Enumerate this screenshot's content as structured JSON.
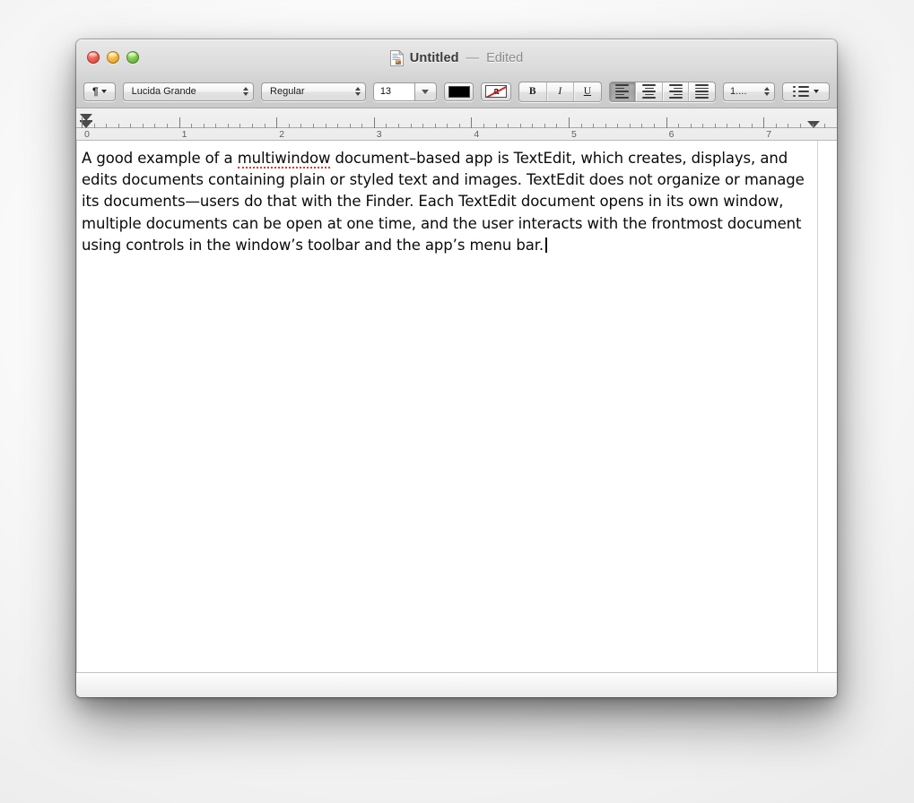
{
  "window": {
    "title": "Untitled",
    "title_separator": "—",
    "status": "Edited",
    "doc_icon": "textedit-document-icon",
    "traffic_lights": [
      {
        "name": "close",
        "label": "Close",
        "color": "#ef5f52"
      },
      {
        "name": "minimize",
        "label": "Minimize",
        "color": "#f6b73c"
      },
      {
        "name": "zoom",
        "label": "Zoom",
        "color": "#7cc84a"
      }
    ]
  },
  "toolbar": {
    "paragraph_style": {
      "glyph": "¶",
      "icon": "pilcrow-icon",
      "label": "Paragraph Styles"
    },
    "font_family": {
      "value": "Lucida Grande"
    },
    "font_typeface": {
      "value": "Regular"
    },
    "font_size": {
      "value": "13"
    },
    "text_color": {
      "label": "Text Color",
      "value": "#000000"
    },
    "background_color": {
      "label": "Background Color",
      "glyph": "a",
      "value": "#ffffff",
      "strike_color": "#e02020"
    },
    "style_buttons": [
      {
        "name": "bold",
        "label": "B"
      },
      {
        "name": "italic",
        "label": "I"
      },
      {
        "name": "underline",
        "label": "U"
      }
    ],
    "alignment_buttons": [
      {
        "name": "align-left",
        "label": "Align Left",
        "selected": true
      },
      {
        "name": "align-center",
        "label": "Center",
        "selected": false
      },
      {
        "name": "align-right",
        "label": "Align Right",
        "selected": false
      },
      {
        "name": "align-justify",
        "label": "Justify",
        "selected": false
      }
    ],
    "line_spacing": {
      "value": "1....",
      "label": "Line Spacing"
    },
    "lists": {
      "label": "Lists",
      "icon": "bullet-list-icon"
    }
  },
  "ruler": {
    "unit_labels": [
      "0",
      "1",
      "2",
      "3",
      "4",
      "5",
      "6",
      "7"
    ],
    "left_indent_marker": "left-indent-marker",
    "first_line_indent_marker": "first-line-indent-marker",
    "right_indent_marker": "right-indent-marker"
  },
  "document": {
    "text_before_misspelling": "A good example of a ",
    "misspelled_word": "multiwindow",
    "text_after_misspelling": " document–based app is TextEdit, which creates, displays, and edits documents containing plain or styled text and images. TextEdit does not organize or manage its documents—users do that with the Finder. Each TextEdit document opens in its own window, multiple documents can be open at one time, and the user interacts with the frontmost document using controls in the window’s toolbar and the app’s menu bar."
  }
}
